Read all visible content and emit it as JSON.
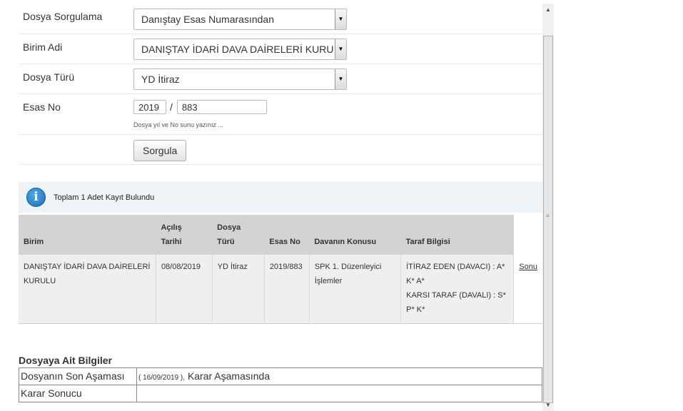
{
  "form": {
    "sorgulama": {
      "label": "Dosya Sorgulama",
      "value": "Danıştay Esas Numarasından"
    },
    "birim": {
      "label": "Birim Adi",
      "value": "DANIŞTAY İDARİ DAVA DAİRELERİ KURULU"
    },
    "dosya_turu": {
      "label": "Dosya Türü",
      "value": "YD İtiraz"
    },
    "esas_no": {
      "label": "Esas No",
      "year": "2019",
      "number": "883",
      "hint": "Dosya yıl ve No sunu yazınız ..."
    },
    "submit_label": "Sorgula"
  },
  "info": {
    "icon": "info-icon",
    "glyph": "i",
    "message": "Toplam 1 Adet Kayıt Bulundu"
  },
  "results": {
    "headers": {
      "birim": "Birim",
      "acilis_1": "Açılış",
      "acilis_2": "Tarihi",
      "dosya_1": "Dosya",
      "dosya_2": "Türü",
      "esas": "Esas No",
      "konu": "Davanın Konusu",
      "taraf": "Taraf Bilgisi"
    },
    "rows": [
      {
        "birim": "DANIŞTAY İDARİ DAVA DAİRELERİ KURULU",
        "tarih": "08/08/2019",
        "tur": "YD İtiraz",
        "esas": "2019/883",
        "konu": "SPK 1. Düzenleyici İşlemler",
        "taraf_1": "İTİRAZ EDEN (DAVACI) : A* K* A*",
        "taraf_2": "KARSI TARAF (DAVALI) : S* P* K*",
        "link": "Sonu"
      }
    ]
  },
  "details": {
    "title": "Dosyaya Ait Bilgiler",
    "son_asama_label": "Dosyanın Son Aşaması",
    "son_asama_date": "( 16/09/2019 ),",
    "son_asama_value": "Karar Aşamasında",
    "karar_label": "Karar Sonucu",
    "karar_value": ""
  },
  "scrollbar": {
    "up": "▲",
    "down": "▼",
    "grip": "≡"
  }
}
